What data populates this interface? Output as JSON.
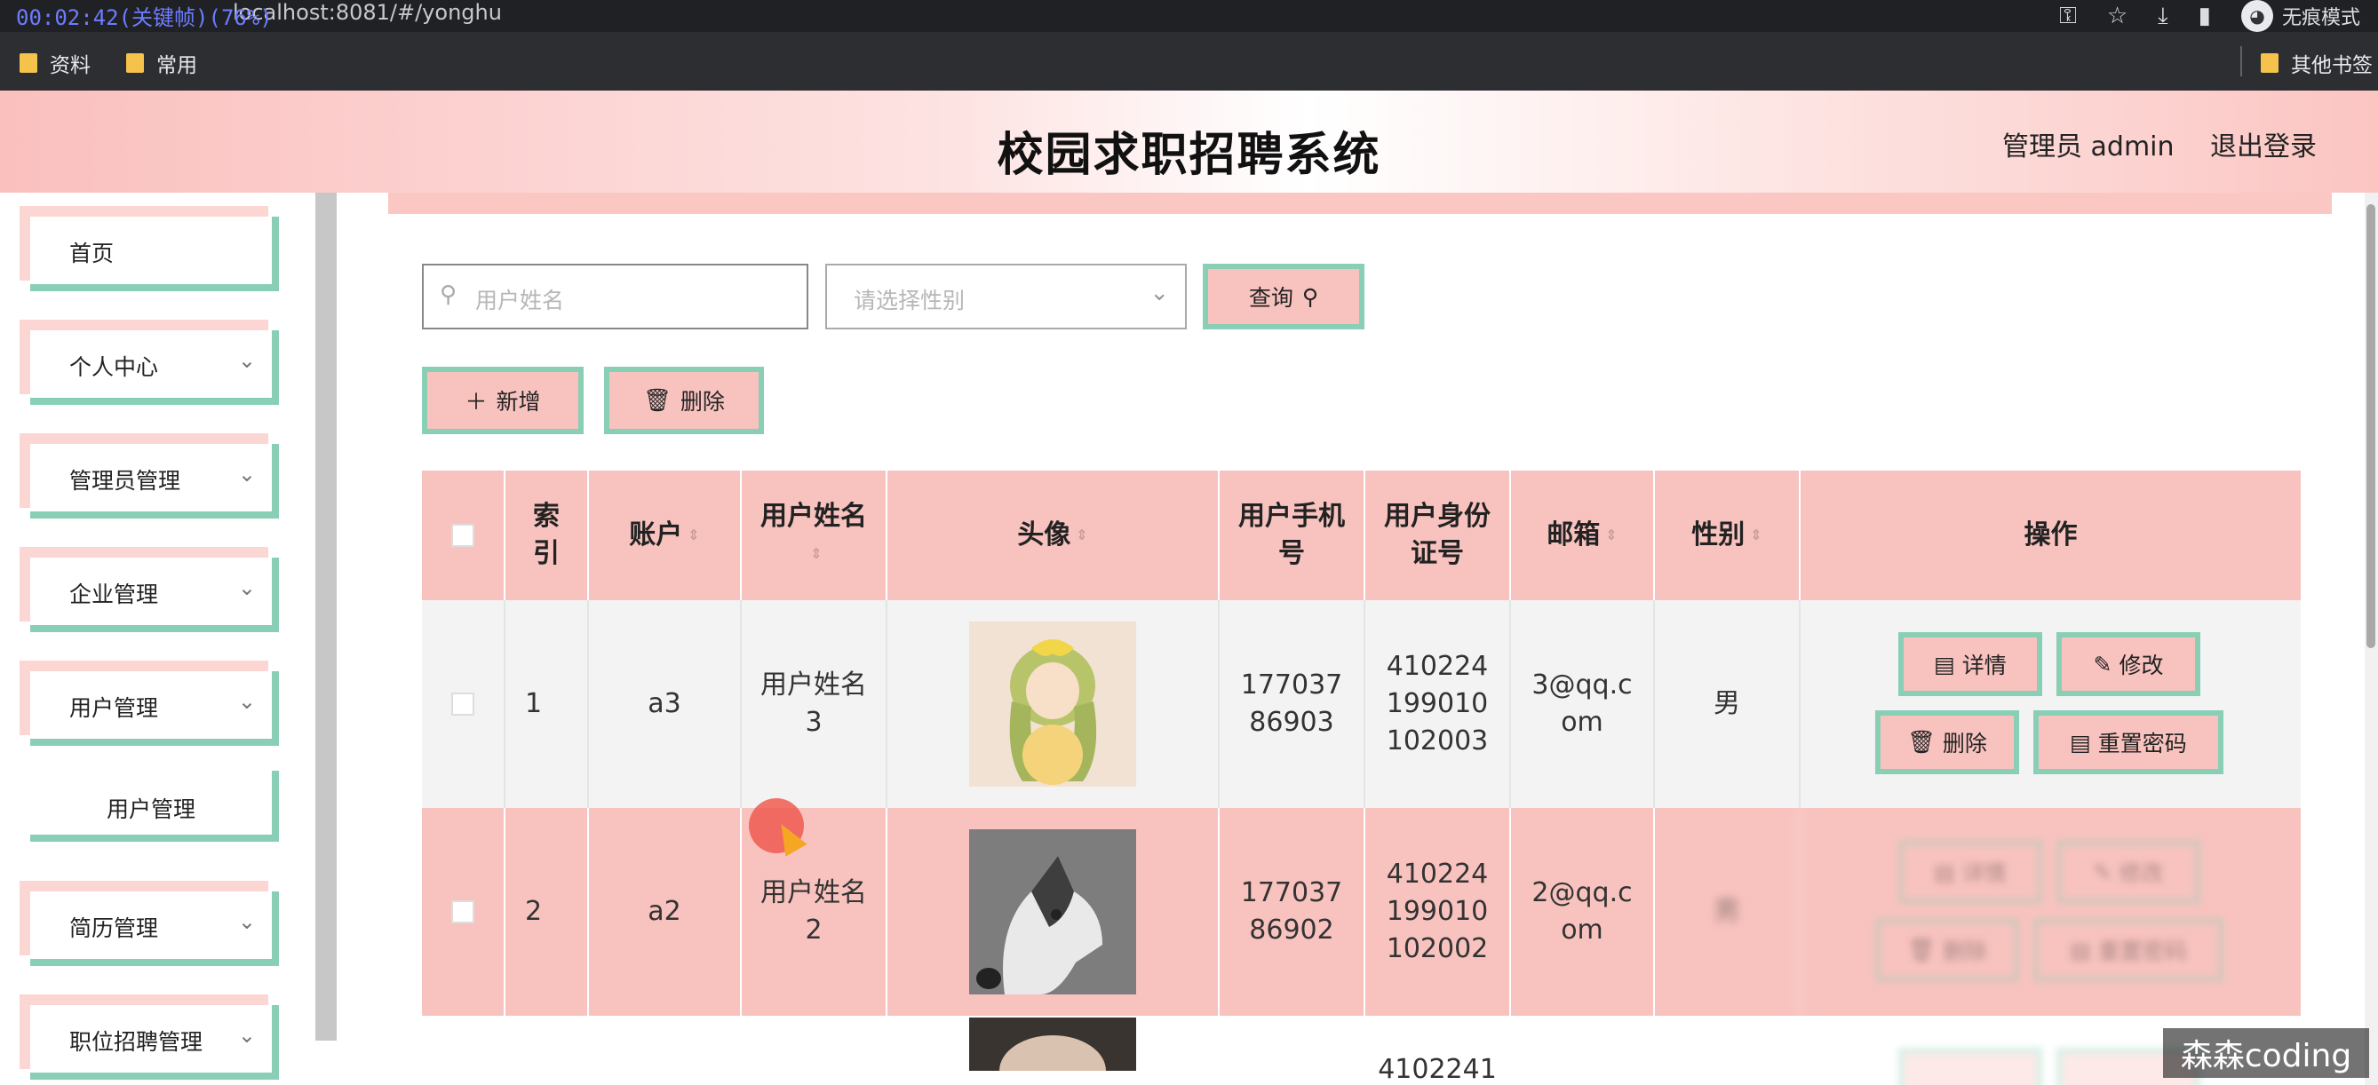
{
  "browser": {
    "timestamp": "00:02:42(关键帧)(76%)",
    "url": "localhost:8081/#/yonghu",
    "incognito_label": "无痕模式",
    "bookmarks": [
      "资料",
      "常用"
    ],
    "other_bookmarks": "其他书签"
  },
  "header": {
    "title": "校园求职招聘系统",
    "admin": "管理员 admin",
    "logout": "退出登录"
  },
  "sidebar": {
    "items": [
      {
        "label": "首页"
      },
      {
        "label": "个人中心"
      },
      {
        "label": "管理员管理"
      },
      {
        "label": "企业管理"
      },
      {
        "label": "用户管理"
      },
      {
        "label": "用户管理"
      },
      {
        "label": "简历管理"
      },
      {
        "label": "职位招聘管理"
      }
    ]
  },
  "search": {
    "name_placeholder": "用户姓名",
    "gender_placeholder": "请选择性别",
    "query_label": "查询"
  },
  "toolbar": {
    "add_label": "新增",
    "delete_label": "删除"
  },
  "table": {
    "headers": [
      "索引",
      "账户",
      "用户姓名",
      "头像",
      "用户手机号",
      "用户身份证号",
      "邮箱",
      "性别",
      "操作"
    ],
    "rows": [
      {
        "index": "1",
        "account": "a3",
        "name": "用户姓名3",
        "phone": "17703786903",
        "idcard": "410224199010102003",
        "email": "3@qq.com",
        "gender": "男"
      },
      {
        "index": "2",
        "account": "a2",
        "name": "用户姓名2",
        "phone": "17703786902",
        "idcard": "410224199010102002",
        "email": "2@qq.com",
        "gender": "男"
      },
      {
        "index": "",
        "account": "",
        "name": "",
        "phone": "",
        "idcard": "4102241",
        "email": "",
        "gender": ""
      }
    ],
    "actions": {
      "detail": "详情",
      "edit": "修改",
      "delete": "删除",
      "reset": "重置密码"
    }
  },
  "watermark": "森森coding",
  "colors": {
    "accent_pink": "#f8c3bf",
    "accent_green": "#89cfb5"
  }
}
